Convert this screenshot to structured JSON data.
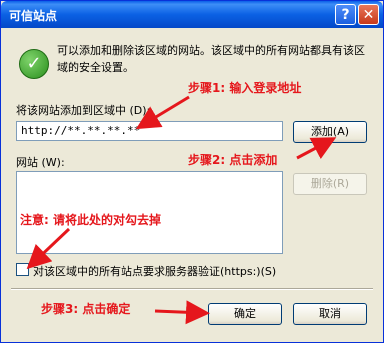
{
  "window": {
    "title": "可信站点",
    "help_label": "?",
    "close_label": "✕"
  },
  "description": "可以添加和删除该区域的网站。该区域中的所有网站都具有该区域的安全设置。",
  "add_section": {
    "label": "将该网站添加到区域中 (D):",
    "value": "http://**.**.**.**",
    "add_button": "添加(A)"
  },
  "sites_section": {
    "label": "网站 (W):",
    "remove_button": "删除(R)"
  },
  "checkbox_label": "对该区域中的所有站点要求服务器验证(https:)(S)",
  "buttons": {
    "ok": "确定",
    "cancel": "取消"
  },
  "annotations": {
    "step1": "步骤1: 输入登录地址",
    "step2": "步骤2: 点击添加",
    "step3": "步骤3: 点击确定",
    "note": "注意: 请将此处的对勾去掉"
  },
  "colors": {
    "annotation": "#e5171c",
    "titlebar": "#0b61e4"
  }
}
